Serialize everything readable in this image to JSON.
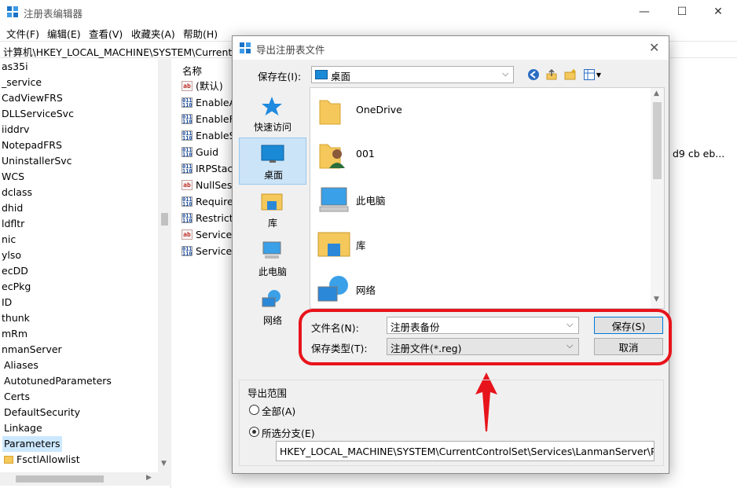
{
  "app": {
    "title": "注册表编辑器",
    "menu": [
      "文件(F)",
      "编辑(E)",
      "查看(V)",
      "收藏夹(A)",
      "帮助(H)"
    ],
    "address": "计算机\\HKEY_LOCAL_MACHINE\\SYSTEM\\CurrentCo",
    "window_buttons": {
      "minimize": "—",
      "maximize": "☐",
      "close": "✕"
    }
  },
  "tree": {
    "items": [
      "as35i",
      "_service",
      "CadViewFRS",
      "DLLServiceSvc",
      "iiddrv",
      "NotepadFRS",
      "UninstallerSvc",
      "WCS",
      "dclass",
      "dhid",
      "ldfltr",
      "nic",
      "ylso",
      "ecDD",
      "ecPkg",
      "ID",
      "thunk",
      "mRm",
      "nmanServer",
      "Aliases",
      "AutotunedParameters",
      "Certs",
      "DefaultSecurity",
      "Linkage",
      "Parameters",
      "FsctlAllowlist"
    ],
    "selected": "Parameters"
  },
  "values": {
    "column_name": "名称",
    "rows": [
      {
        "name": "(默认)",
        "type": "str"
      },
      {
        "name": "EnableA",
        "type": "bin"
      },
      {
        "name": "EnableFo",
        "type": "bin"
      },
      {
        "name": "EnableSe",
        "type": "bin"
      },
      {
        "name": "Guid",
        "type": "bin"
      },
      {
        "name": "IRPStack",
        "type": "bin"
      },
      {
        "name": "NullSess",
        "type": "str"
      },
      {
        "name": "RequireS",
        "type": "bin"
      },
      {
        "name": "RestrictN",
        "type": "bin"
      },
      {
        "name": "ServiceD",
        "type": "str"
      },
      {
        "name": "ServiceD",
        "type": "bin"
      }
    ],
    "guid_data_partial": "d9 cb eb..."
  },
  "dialog": {
    "title": "导出注册表文件",
    "close": "✕",
    "save_in_label": "保存在(I):",
    "save_in_value": "桌面",
    "places": [
      "快速访问",
      "桌面",
      "库",
      "此电脑",
      "网络"
    ],
    "selected_place": "桌面",
    "files": [
      "OneDrive",
      "001",
      "此电脑",
      "库",
      "网络"
    ],
    "file_name_label": "文件名(N):",
    "file_name_value": "注册表备份",
    "file_type_label": "保存类型(T):",
    "file_type_value": "注册文件(*.reg)",
    "save_button": "保存(S)",
    "cancel_button": "取消",
    "export_range": {
      "title": "导出范围",
      "option_all": "全部(A)",
      "option_selected": "所选分支(E)",
      "selected_option": "option_selected",
      "branch_path": "HKEY_LOCAL_MACHINE\\SYSTEM\\CurrentControlSet\\Services\\LanmanServer\\Paran"
    }
  },
  "colors": {
    "annotation": "#e8141c",
    "selection": "#cce8ff",
    "accent": "#0078d7"
  }
}
